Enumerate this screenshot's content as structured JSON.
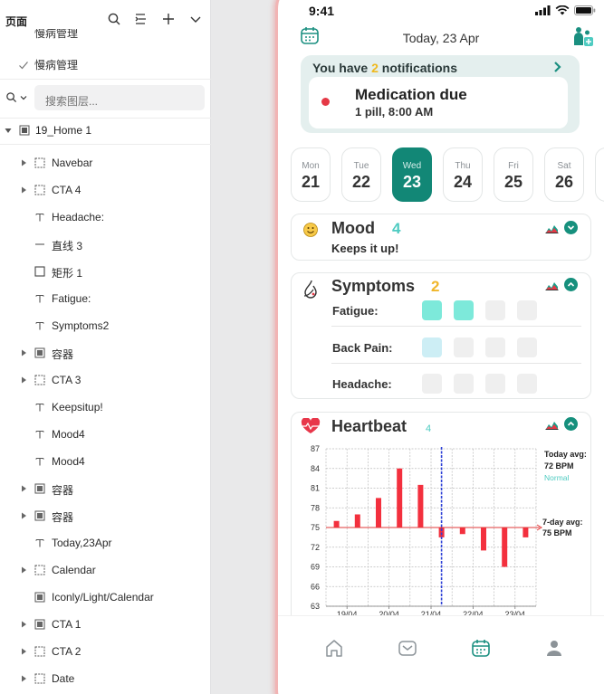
{
  "panel": {
    "title": "页面",
    "cutoff_item": "慢病管理",
    "checked_page": "慢病管理",
    "search_placeholder": "搜索图层...",
    "page_name": "19_Home 1",
    "layers": [
      {
        "name": "Navebar",
        "kind": "frame",
        "expandable": true
      },
      {
        "name": "CTA 4",
        "kind": "frame",
        "expandable": true
      },
      {
        "name": "Headache:",
        "kind": "text",
        "expandable": false
      },
      {
        "name": "直线 3",
        "kind": "line",
        "expandable": false
      },
      {
        "name": "矩形 1",
        "kind": "rect",
        "expandable": false
      },
      {
        "name": "Fatigue:",
        "kind": "text",
        "expandable": false
      },
      {
        "name": "Symptoms2",
        "kind": "text",
        "expandable": false
      },
      {
        "name": "容器",
        "kind": "group",
        "expandable": true
      },
      {
        "name": "CTA 3",
        "kind": "frame",
        "expandable": true
      },
      {
        "name": "Keepsitup!",
        "kind": "text",
        "expandable": false
      },
      {
        "name": "Mood4",
        "kind": "text",
        "expandable": false
      },
      {
        "name": "Mood4",
        "kind": "text",
        "expandable": false
      },
      {
        "name": "容器",
        "kind": "group",
        "expandable": true
      },
      {
        "name": "容器",
        "kind": "group",
        "expandable": true
      },
      {
        "name": "Today,23Apr",
        "kind": "text",
        "expandable": false
      },
      {
        "name": "Calendar",
        "kind": "frame",
        "expandable": true
      },
      {
        "name": "Iconly/Light/Calendar",
        "kind": "group",
        "expandable": false
      },
      {
        "name": "CTA 1",
        "kind": "group",
        "expandable": true
      },
      {
        "name": "CTA 2",
        "kind": "frame",
        "expandable": true
      },
      {
        "name": "Date",
        "kind": "frame",
        "expandable": true
      }
    ]
  },
  "phone": {
    "status_time": "9:41",
    "date_title": "Today, 23 Apr",
    "notification": {
      "prefix": "You have ",
      "count": "2",
      "suffix": " notifications",
      "title": "Medication due",
      "subtitle": "1 pill, 8:00 AM"
    },
    "days": [
      {
        "name": "Mon",
        "num": "21",
        "active": false
      },
      {
        "name": "Tue",
        "num": "22",
        "active": false
      },
      {
        "name": "Wed",
        "num": "23",
        "active": true
      },
      {
        "name": "Thu",
        "num": "24",
        "active": false
      },
      {
        "name": "Fri",
        "num": "25",
        "active": false
      },
      {
        "name": "Sat",
        "num": "26",
        "active": false
      }
    ],
    "mood": {
      "title": "Mood",
      "value": "4",
      "subtitle": "Keeps it up!"
    },
    "symptoms": {
      "title": "Symptoms",
      "value": "2",
      "rows": [
        {
          "label": "Fatigue:",
          "level": 2,
          "color": "#7de9da"
        },
        {
          "label": "Back Pain:",
          "level": 1,
          "color": "#cdeef5"
        },
        {
          "label": "Headache:",
          "level": 0,
          "color": "#efefef"
        }
      ]
    },
    "heartbeat": {
      "title": "Heartbeat",
      "value": "4",
      "today_label": "Today avg:",
      "today_value": "72 BPM",
      "today_status": "Normal",
      "week_label": "7-day avg:",
      "week_value": "75 BPM"
    },
    "tabs": [
      "home-icon",
      "message-icon",
      "calendar-icon",
      "profile-icon"
    ],
    "colors": {
      "accent": "#128776",
      "alert": "#e53946",
      "bar": "#f3303e",
      "avg_line": "#e23a3a",
      "today_line": "#2c3fd6"
    }
  },
  "chart_data": {
    "type": "bar",
    "title": "",
    "xlabel": "",
    "ylabel": "",
    "ylim": [
      63,
      87
    ],
    "yticks": [
      63,
      66,
      69,
      72,
      75,
      78,
      81,
      84,
      87
    ],
    "baseline": 75,
    "x_tick_labels": [
      "19/04",
      "20/04",
      "21/04",
      "22/04",
      "23/04"
    ],
    "values": [
      76,
      77,
      79.5,
      84,
      81.5,
      73.5,
      74,
      71.5,
      69,
      73.5
    ],
    "today_marker_after_index": 5,
    "avg_7day": 75,
    "avg_today": 72,
    "grid": true
  }
}
